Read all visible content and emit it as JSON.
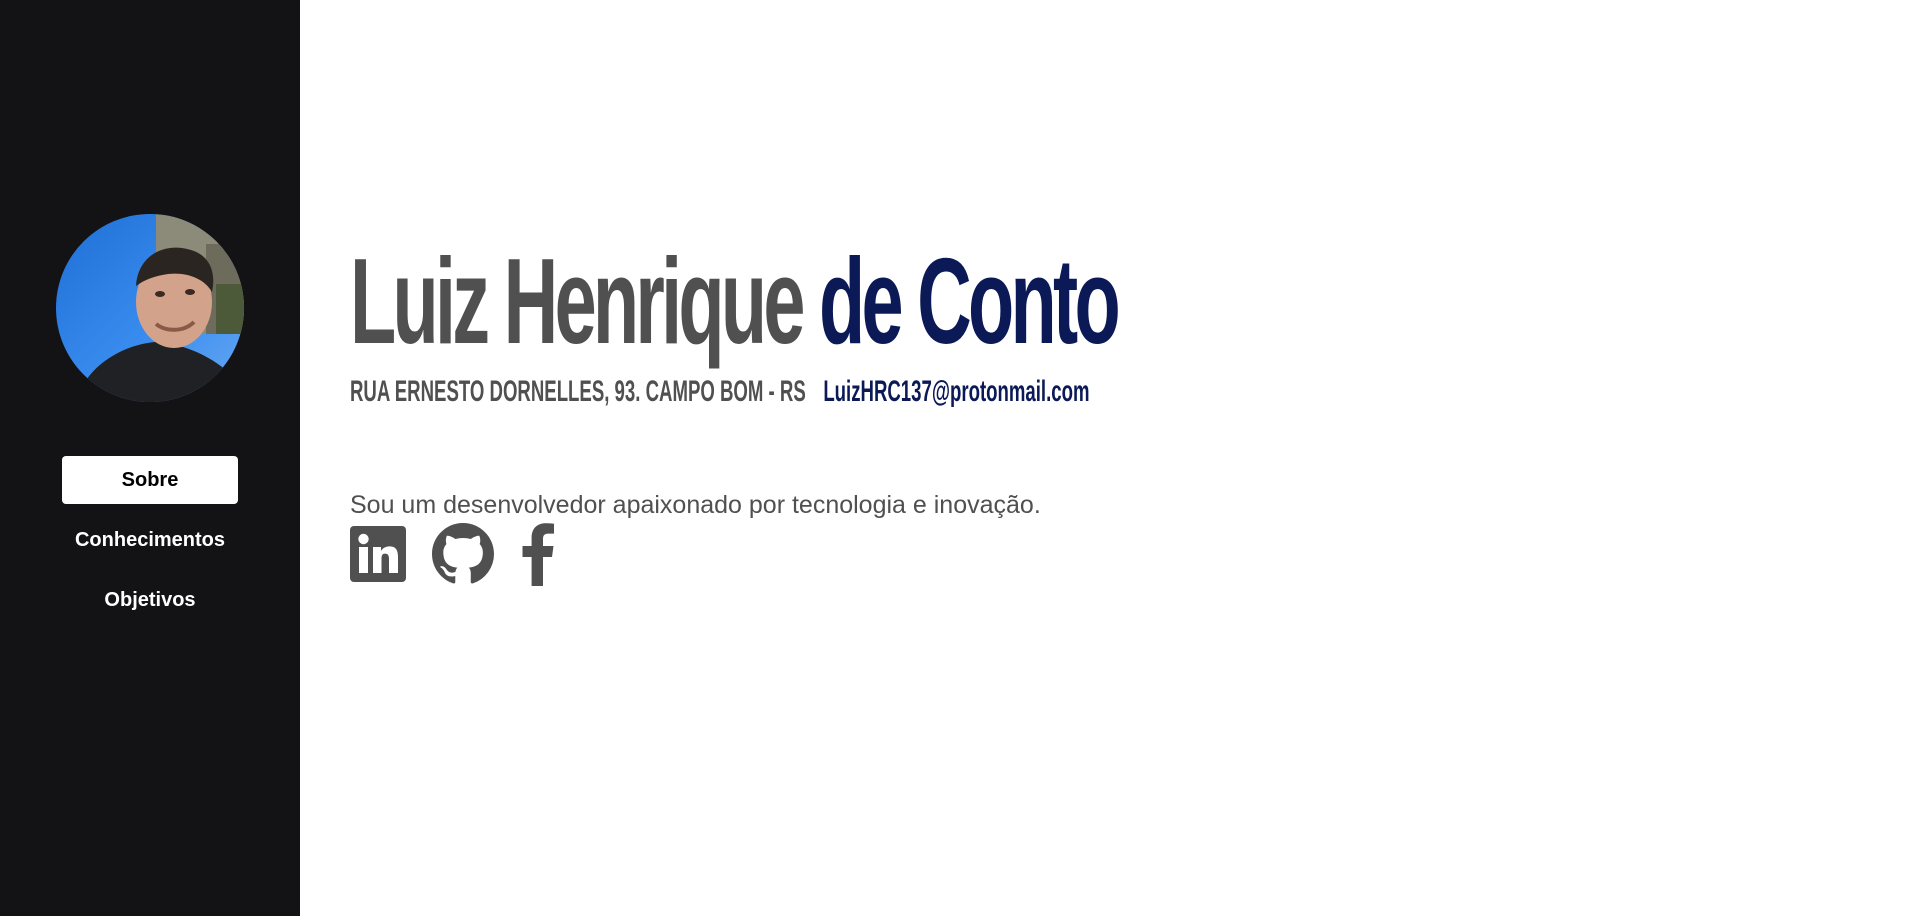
{
  "sidebar": {
    "avatar_alt": "profile photo",
    "nav": {
      "items": [
        {
          "label": "Sobre",
          "active": true
        },
        {
          "label": "Conhecimentos",
          "active": false
        },
        {
          "label": "Objetivos",
          "active": false
        }
      ]
    }
  },
  "main": {
    "name": {
      "first": "Luiz Henrique",
      "last": "de Conto"
    },
    "contact": {
      "address": "RUA ERNESTO DORNELLES, 93. CAMPO BOM - RS",
      "email": "LuizHRC137@protonmail.com"
    },
    "bio": "Sou um desenvolvedor apaixonado por tecnologia e inovação.",
    "social": [
      {
        "icon": "linkedin-icon"
      },
      {
        "icon": "github-icon"
      },
      {
        "icon": "facebook-icon"
      }
    ]
  },
  "colors": {
    "sidebar_bg": "#131315",
    "text_gray": "#505050",
    "accent_navy": "#0b1a57",
    "active_nav_bg": "#ffffff"
  }
}
